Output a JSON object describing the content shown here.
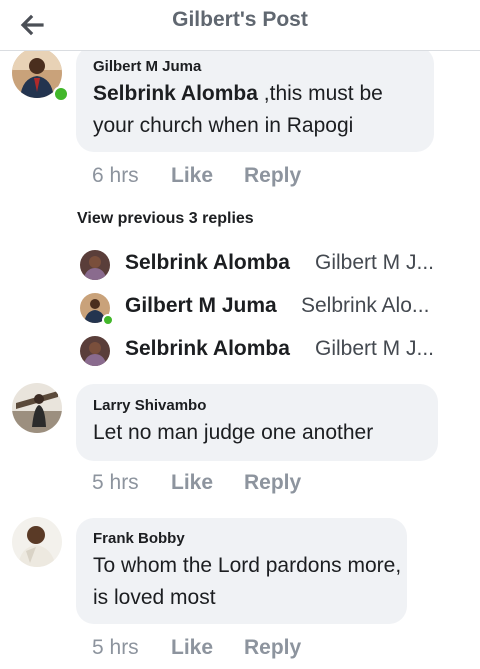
{
  "header": {
    "back_icon": "arrow-left-icon",
    "title": "Gilbert's Post"
  },
  "comment1": {
    "author": "Gilbert M Juma",
    "mention": "Selbrink Alomba",
    "text": " ,this must be your church when in Rapogi",
    "time": "6 hrs",
    "like": "Like",
    "reply": "Reply",
    "online": true
  },
  "replies": {
    "view_previous": "View previous 3 replies",
    "items": [
      {
        "name": "Selbrink Alomba",
        "text": "Gilbert M J..."
      },
      {
        "name": "Gilbert M Juma",
        "text": "Selbrink Alo..."
      },
      {
        "name": "Selbrink Alomba",
        "text": "Gilbert M J..."
      }
    ]
  },
  "comment2": {
    "author": "Larry Shivambo",
    "text": "Let no man judge one another",
    "time": "5 hrs",
    "like": "Like",
    "reply": "Reply"
  },
  "comment3": {
    "author": "Frank Bobby",
    "text": "To whom the Lord  pardons more, is loved most",
    "time": "5 hrs",
    "like": "Like",
    "reply": "Reply"
  },
  "colors": {
    "bubble": "#f0f2f5",
    "online": "#42b72a",
    "meta": "#8d949e"
  }
}
